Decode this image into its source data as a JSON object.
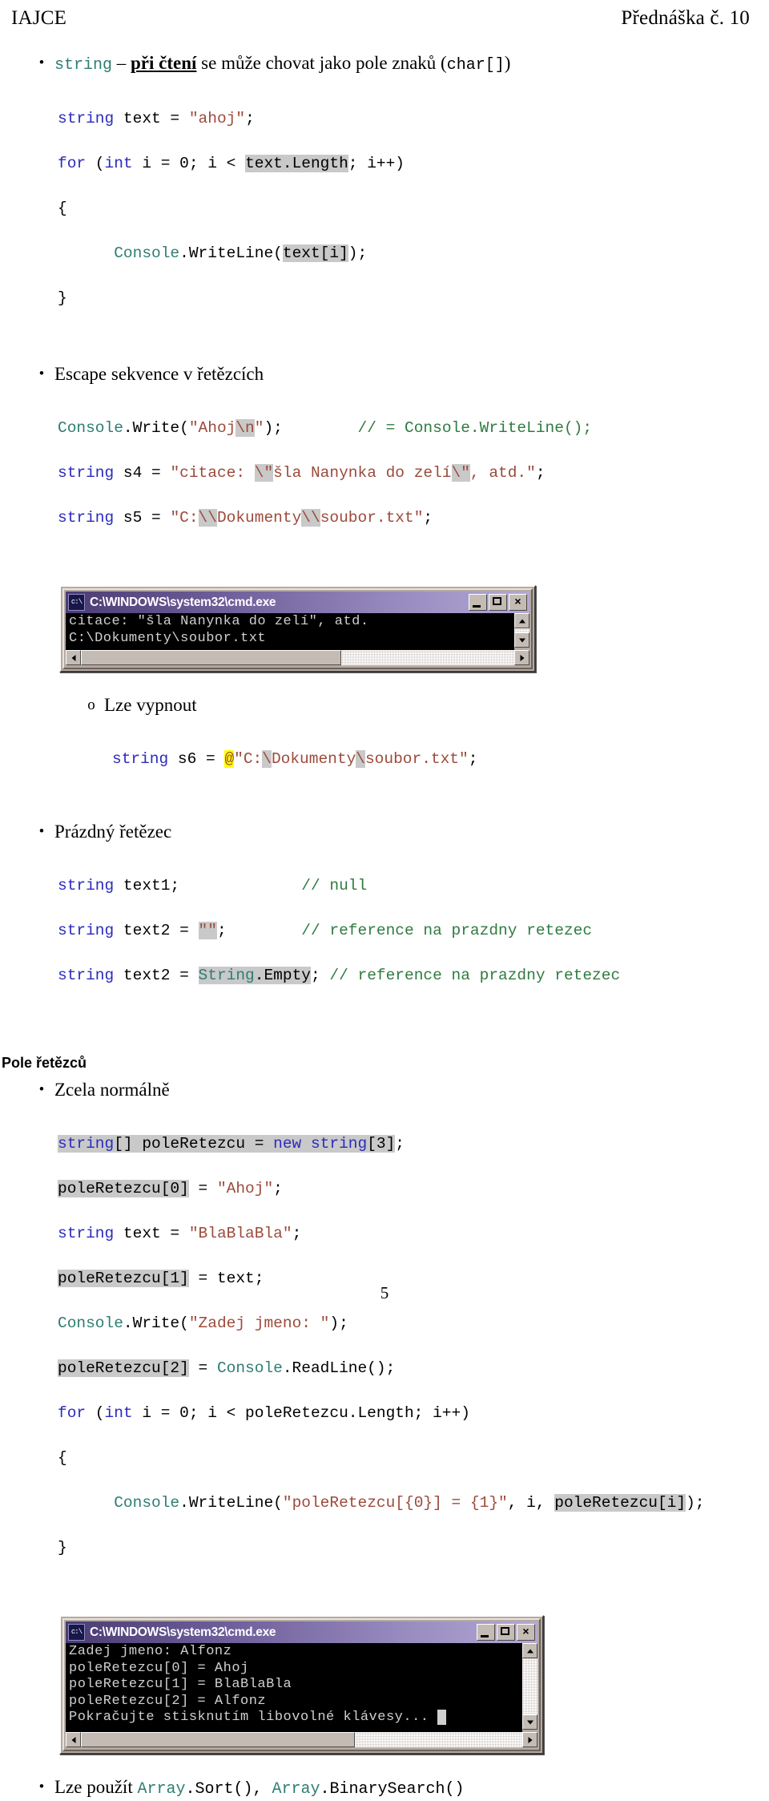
{
  "header": {
    "left": "IAJCE",
    "right": "Přednáška č. 10"
  },
  "page_number": "5",
  "bullets": {
    "string_reading_pre": "string",
    "string_reading_dash": " – ",
    "string_reading_emph": "při čtení",
    "string_reading_mid": " se může chovat jako pole znaků (",
    "string_reading_code": "char[]",
    "string_reading_post": ")",
    "escape": "Escape sekvence v řetězcích",
    "lze_vypnout": "Lze vypnout",
    "prazdny_retezec": "Prázdný řetězec",
    "pole_retezcu_heading": "Pole řetězců",
    "zcela_normalne": "Zcela normálně",
    "lze_pouzit_pre": "Lze použít ",
    "lze_pouzit_c1": "Array",
    "lze_pouzit_c1b": ".Sort()",
    "lze_pouzit_sep": ", ",
    "lze_pouzit_c2": "Array",
    "lze_pouzit_c2b": ".BinarySearch()"
  },
  "markers": {
    "disc": "•",
    "circle": "o"
  },
  "code_block_1": {
    "l1_kw": "string",
    "l1_mid": " text = ",
    "l1_str": "\"ahoj\"",
    "l1_end": ";",
    "l2_kw1": "for",
    "l2_a": " (",
    "l2_kw2": "int",
    "l2_b": " i = 0; i < ",
    "l2_hl": "text.Length",
    "l2_c": "; i++)",
    "l3": "{",
    "l4_cls": "Console",
    "l4_a": ".WriteLine(",
    "l4_hl": "text[i]",
    "l4_b": ");",
    "l5": "}"
  },
  "code_block_2": {
    "l1_cls": "Console",
    "l1_a": ".Write(",
    "l1_str1": "\"Ahoj",
    "l1_esc": "\\n",
    "l1_str2": "\"",
    "l1_b": ");",
    "l1_gap": "        ",
    "l1_cmt": "// = Console.WriteLine();",
    "l2_kw": "string",
    "l2_a": " s4 = ",
    "l2_str1": "\"citace: ",
    "l2_esc1": "\\\"",
    "l2_str2": "šla Nanynka do zelí",
    "l2_esc2": "\\\"",
    "l2_str3": ", atd.\"",
    "l2_b": ";",
    "l3_kw": "string",
    "l3_a": " s5 = ",
    "l3_str1": "\"C:",
    "l3_esc1": "\\\\",
    "l3_str2": "Dokumenty",
    "l3_esc2": "\\\\",
    "l3_str3": "soubor.txt\"",
    "l3_b": ";"
  },
  "code_block_3": {
    "kw": "string",
    "a": " s6 = ",
    "at": "@",
    "str1": "\"C:",
    "esc1": "\\",
    "str2": "Dokumenty",
    "esc2": "\\",
    "str3": "soubor.txt\"",
    "b": ";"
  },
  "code_block_4": {
    "l1_kw": "string",
    "l1_a": " text1;",
    "l1_gap": "             ",
    "l1_cmt": "// null",
    "l2_kw": "string",
    "l2_a": " text2 = ",
    "l2_hl": "\"\"",
    "l2_b": ";",
    "l2_gap": "        ",
    "l2_cmt": "// reference na prazdny retezec",
    "l3_kw": "string",
    "l3_a": " text2 = ",
    "l3_hl_cls": "String",
    "l3_hl_rest": ".Empty",
    "l3_b": "; ",
    "l3_cmt": "// reference na prazdny retezec"
  },
  "code_block_5": {
    "l1_kw1": "string",
    "l1_a": "[] poleRetezcu = ",
    "l1_kw2": "new",
    "l1_b": " ",
    "l1_kw3": "string",
    "l1_c": "[3]",
    "l1_d": ";",
    "l2_hl": "poleRetezcu[0]",
    "l2_a": " = ",
    "l2_str": "\"Ahoj\"",
    "l2_b": ";",
    "l3_kw": "string",
    "l3_a": " text = ",
    "l3_str": "\"BlaBlaBla\"",
    "l3_b": ";",
    "l4_hl": "poleRetezcu[1]",
    "l4_a": " = text;",
    "l5_cls": "Console",
    "l5_a": ".Write(",
    "l5_str": "\"Zadej jmeno: \"",
    "l5_b": ");",
    "l6_hl": "poleRetezcu[2]",
    "l6_a": " = ",
    "l6_cls": "Console",
    "l6_b": ".ReadLine();",
    "l7_kw1": "for",
    "l7_a": " (",
    "l7_kw2": "int",
    "l7_b": " i = 0; i < poleRetezcu.Length; i++)",
    "l8": "{",
    "l9_cls": "Console",
    "l9_a": ".WriteLine(",
    "l9_str": "\"poleRetezcu[{0}] = {1}\"",
    "l9_b": ", i, ",
    "l9_hl": "poleRetezcu[i]",
    "l9_c": ");",
    "l10": "}"
  },
  "console1": {
    "title": "C:\\WINDOWS\\system32\\cmd.exe",
    "icon_label": "c:\\",
    "minimize": "minimize",
    "maximize": "maximize",
    "close": "×",
    "lines": [
      "citace: \"šla Nanynka do zelí\", atd.",
      "C:\\Dokumenty\\soubor.txt"
    ]
  },
  "console2": {
    "title": "C:\\WINDOWS\\system32\\cmd.exe",
    "icon_label": "c:\\",
    "minimize": "minimize",
    "maximize": "maximize",
    "close": "×",
    "lines": [
      "Zadej jmeno: Alfonz",
      "poleRetezcu[0] = Ahoj",
      "poleRetezcu[1] = BlaBlaBla",
      "poleRetezcu[2] = Alfonz",
      "Pokračujte stisknutím libovolné klávesy... "
    ]
  },
  "colors": {
    "keyword": "#2b2bbe",
    "string": "#9c4a3a",
    "class": "#2e7d73",
    "comment": "#2f7b3f",
    "highlight_gray": "#c9c9c9",
    "highlight_yellow": "#ffff00",
    "console_bg": "#000000",
    "console_fg": "#cfcfcf",
    "titlebar": "#6f5f9b"
  }
}
